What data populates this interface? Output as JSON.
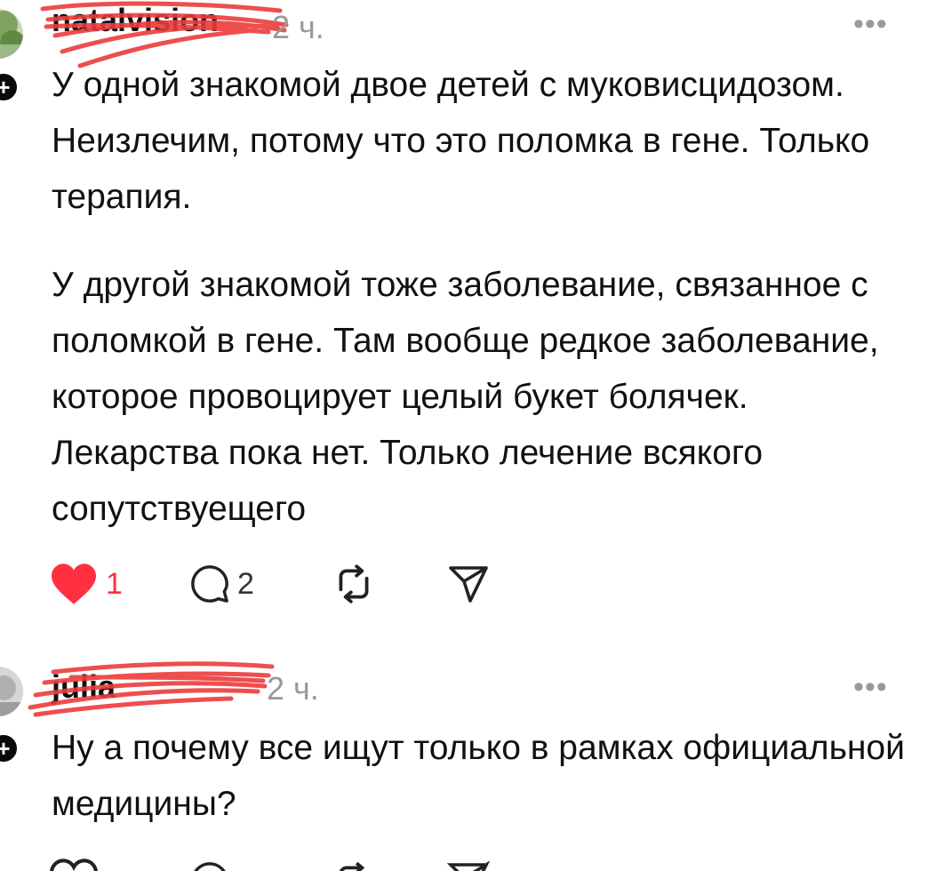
{
  "post1": {
    "username": "natalvision",
    "time": "2 ч.",
    "more": "•••",
    "paragraphs": [
      "У одной знакомой двое детей с муковисцидозом. Неизлечим, потому что это поломка в гене. Только терапия.",
      "У другой знакомой тоже заболевание, связанное с поломкой в гене. Там вообще редкое заболевание, которое провоцирует целый букет болячек. Лекарства пока нет. Только лечение всякого сопутствуещего"
    ],
    "likes": "1",
    "comments": "2",
    "liked": true
  },
  "post2": {
    "username": "julia",
    "time": "2 ч.",
    "more": "•••",
    "paragraphs": [
      "Ну а почему все ищут только в рамках официальной медицины?"
    ]
  },
  "icons": [
    "heart-icon",
    "comment-icon",
    "repost-icon",
    "share-icon",
    "plus-icon",
    "more-icon"
  ],
  "colors": {
    "like": "#ff3040",
    "scribble": "#ec3b3b",
    "secondary_text": "#999999"
  }
}
